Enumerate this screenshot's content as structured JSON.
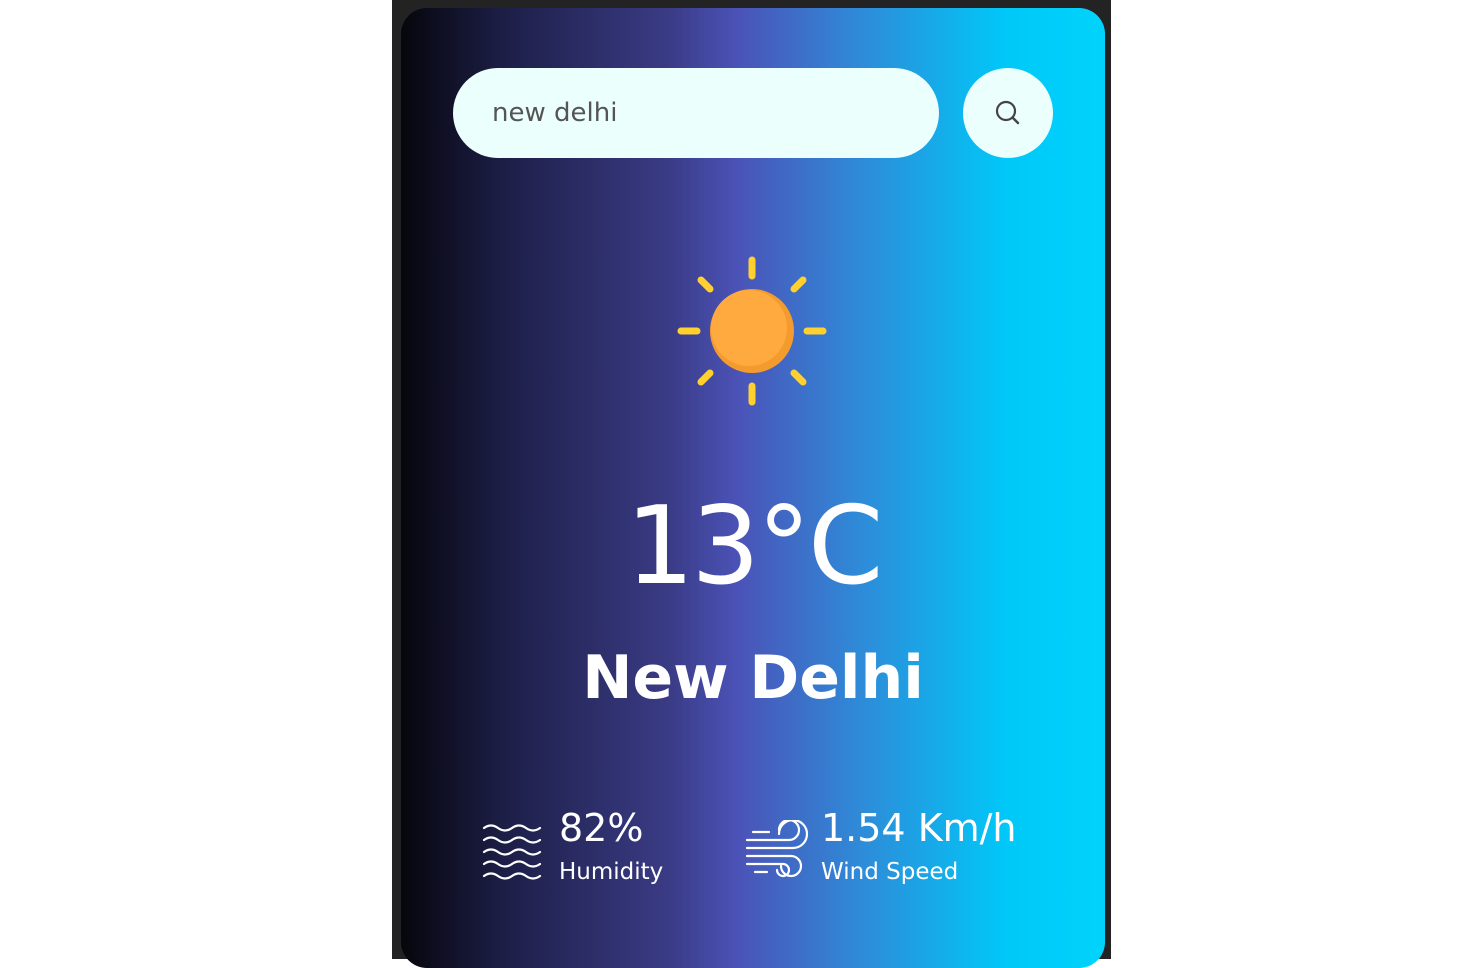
{
  "search": {
    "value": "new delhi",
    "placeholder": "",
    "icon": "search-icon"
  },
  "weather": {
    "icon": "sun-icon",
    "temperature": "13°C",
    "city": "New Delhi"
  },
  "details": {
    "humidity": {
      "icon": "humidity-icon",
      "value": "82%",
      "label": "Humidity"
    },
    "wind": {
      "icon": "wind-icon",
      "value": "1.54 Km/h",
      "label": "Wind Speed"
    }
  },
  "colors": {
    "gradient_start": "#06060c",
    "gradient_mid": "#4b53b8",
    "gradient_end": "#00d3fb",
    "search_bg": "#ebfffc",
    "sun_core": "#ffa93a",
    "sun_rays": "#ffd02e"
  }
}
